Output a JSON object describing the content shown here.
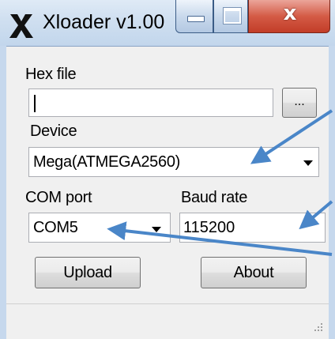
{
  "window": {
    "title": "Xloader v1.00",
    "close_glyph": "x",
    "accent_color": "#4a86c8"
  },
  "form": {
    "hex_file": {
      "label": "Hex file",
      "value": "",
      "browse_label": "..."
    },
    "device": {
      "label": "Device",
      "selected": "Mega(ATMEGA2560)"
    },
    "com_port": {
      "label": "COM port",
      "selected": "COM5"
    },
    "baud_rate": {
      "label": "Baud rate",
      "value": "115200"
    },
    "buttons": {
      "upload_label": "Upload",
      "about_label": "About"
    }
  },
  "icons": {
    "app": "xloader-x-icon",
    "minimize": "minimize-icon",
    "maximize": "maximize-icon",
    "close": "close-icon",
    "dropdown": "chevron-down-icon",
    "grip": "resize-grip-icon",
    "annotation": "arrow-icon"
  }
}
